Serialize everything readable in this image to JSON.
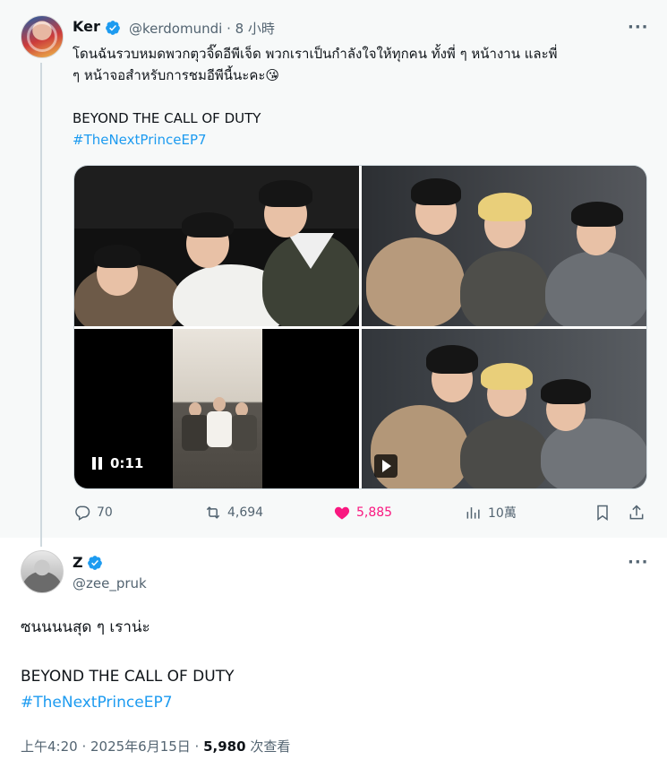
{
  "parent_tweet": {
    "display_name": "Ker",
    "handle": "@kerdomundi",
    "time": "· 8 小時",
    "text_line1": "โดนฉันรวบหมดพวกตุวจิ๊ดอีพีเจ็ด พวกเราเป็นกำลังใจให้ทุกคน ทั้งพี่ ๆ หน้างาน และพี่",
    "text_line2": "ๆ หน้าจอสำหรับการชมอีพีนี้นะคะ😘",
    "text_line3": "BEYOND THE CALL OF DUTY",
    "hashtag": "#TheNextPrinceEP7",
    "video_duration": "0:11",
    "stats": {
      "replies": "70",
      "reposts": "4,694",
      "likes": "5,885",
      "views": "10萬"
    }
  },
  "reply_tweet": {
    "display_name": "Z",
    "handle": "@zee_pruk",
    "text_line1": "ซนนนนสุด ๆ เราน่ะ",
    "text_line2": "BEYOND THE CALL OF DUTY",
    "hashtag": "#TheNextPrinceEP7",
    "timestamp": "上午4:20 · 2025年6月15日 · ",
    "views_count": "5,980",
    "views_label": " 次查看"
  },
  "icons": [
    "verified-badge-icon",
    "more-options-icon",
    "reply-icon",
    "repost-icon",
    "like-icon",
    "views-icon",
    "bookmark-icon",
    "share-icon",
    "pause-icon",
    "play-icon"
  ],
  "colors": {
    "accent": "#1d9bf0",
    "like": "#f91880",
    "muted": "#536471",
    "text": "#0f1419"
  }
}
